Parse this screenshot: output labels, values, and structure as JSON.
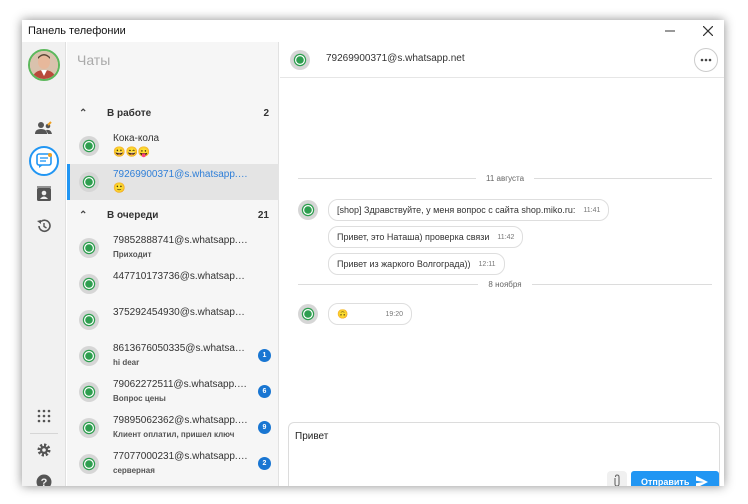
{
  "window": {
    "title": "Панель телефонии"
  },
  "colors": {
    "accent": "#2196f3",
    "whatsapp": "#25d366",
    "badge": "#1976d2"
  },
  "sidebar": {
    "icons": [
      "contacts-icon",
      "chats-icon",
      "address-book-icon",
      "history-icon",
      "dialpad-icon",
      "settings-icon",
      "help-icon"
    ]
  },
  "chat_list": {
    "header": "Чаты",
    "groups": [
      {
        "name": "В работе",
        "count": "2"
      },
      {
        "name": "В очереди",
        "count": "21"
      }
    ],
    "in_work": [
      {
        "name": "Кока-кола",
        "preview": "😀😄😛"
      },
      {
        "name": "79269900371@s.whatsapp.net",
        "preview": "🙂"
      }
    ],
    "queue": [
      {
        "name": "79852888741@s.whatsapp.net",
        "preview": "Приходит",
        "badge": ""
      },
      {
        "name": "447710173736@s.whatsapp.net",
        "preview": "",
        "badge": ""
      },
      {
        "name": "375292454930@s.whatsapp.net",
        "preview": "",
        "badge": ""
      },
      {
        "name": "8613676050335@s.whatsapp.net",
        "preview": "hi dear",
        "badge": "1"
      },
      {
        "name": "79062272511@s.whatsapp.net",
        "preview": "Вопрос цены",
        "badge": "6"
      },
      {
        "name": "79895062362@s.whatsapp.net",
        "preview": "Клиент оплатил, пришел ключ",
        "badge": "9"
      },
      {
        "name": "77077000231@s.whatsapp.net",
        "preview": "серверная",
        "badge": "2"
      }
    ]
  },
  "chat": {
    "title": "79269900371@s.whatsapp.net",
    "days": [
      "11 августа",
      "8 ноября"
    ],
    "messages": [
      {
        "text": "[shop] Здравствуйте, у меня вопрос с сайта shop.miko.ru:",
        "time": "11:41"
      },
      {
        "text": "Привет, это Наташа) проверка связи",
        "time": "11:42"
      },
      {
        "text": "Привет из жаркого Волгограда))",
        "time": "12:11"
      },
      {
        "text": "🙃",
        "time": "19:20"
      }
    ],
    "composer": {
      "value": "Привет",
      "send_label": "Отправить"
    }
  }
}
